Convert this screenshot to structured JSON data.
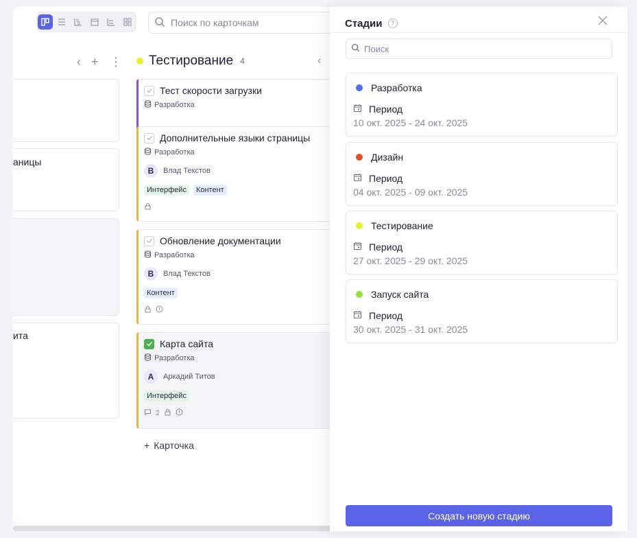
{
  "toolbar": {
    "views": [
      "board-icon",
      "list-icon",
      "gantt-icon",
      "calendar-icon",
      "timeline-icon",
      "grid-icon"
    ],
    "search_placeholder": "Поиск по карточкам"
  },
  "left_column": {
    "cards": [
      {
        "text": ""
      },
      {
        "text": "аницы"
      },
      {
        "text": ""
      },
      {
        "text": "ита"
      }
    ]
  },
  "column": {
    "title": "Тестирование",
    "count": "4",
    "dot_color": "#e5ef2a",
    "add_card_label": "Карточка",
    "cards": [
      {
        "title": "Тест скорости загрузки",
        "project": "Разработка",
        "done": false
      },
      {
        "title": "Дополнительные языки страницы",
        "project": "Разработка",
        "assignee_initial": "В",
        "assignee": "Влад Текстов",
        "tags": [
          "Интерфейс",
          "Контент"
        ],
        "done": false
      },
      {
        "title": "Обновление документации",
        "project": "Разработка",
        "assignee_initial": "В",
        "assignee": "Влад Текстов",
        "tags": [
          "Контент"
        ],
        "done": false
      },
      {
        "title": "Карта сайта",
        "project": "Разработка",
        "assignee_initial": "А",
        "assignee": "Аркадий Титов",
        "tags": [
          "Интерфейс"
        ],
        "comments": "2",
        "done": true
      }
    ]
  },
  "panel": {
    "title": "Стадии",
    "search_placeholder": "Поиск",
    "period_label": "Период",
    "create_button": "Создать новую стадию",
    "stages": [
      {
        "name": "Разработка",
        "color": "#4f6fef",
        "dates": "10 окт. 2025 - 24 окт. 2025"
      },
      {
        "name": "Дизайн",
        "color": "#e0512a",
        "dates": "04 окт. 2025 - 09 окт. 2025"
      },
      {
        "name": "Тестирование",
        "color": "#e5ef2a",
        "dates": "27 окт. 2025 - 29 окт. 2025"
      },
      {
        "name": "Запуск сайта",
        "color": "#8fe53a",
        "dates": "30 окт. 2025 - 31 окт. 2025"
      }
    ]
  }
}
